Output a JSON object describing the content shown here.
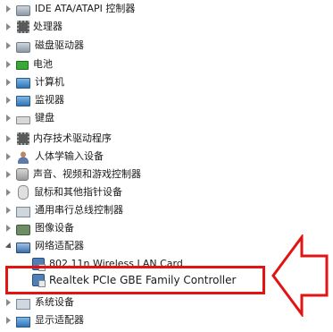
{
  "tree": {
    "items": [
      {
        "label": "IDE ATA/ATAPI 控制器",
        "icon": "disk-controller-icon",
        "expanded": false
      },
      {
        "label": "处理器",
        "icon": "processor-icon",
        "expanded": false
      },
      {
        "label": "磁盘驱动器",
        "icon": "disk-drive-icon",
        "expanded": false
      },
      {
        "label": "电池",
        "icon": "battery-icon",
        "expanded": false
      },
      {
        "label": "计算机",
        "icon": "computer-icon",
        "expanded": false
      },
      {
        "label": "监视器",
        "icon": "monitor-icon",
        "expanded": false
      },
      {
        "label": "键盘",
        "icon": "keyboard-icon",
        "expanded": false
      },
      {
        "label": "内存技术驱动程序",
        "icon": "memory-icon",
        "expanded": false
      },
      {
        "label": "人体学输入设备",
        "icon": "hid-icon",
        "expanded": false
      },
      {
        "label": "声音、视频和游戏控制器",
        "icon": "sound-icon",
        "expanded": false
      },
      {
        "label": "鼠标和其他指针设备",
        "icon": "mouse-icon",
        "expanded": false
      },
      {
        "label": "通用串行总线控制器",
        "icon": "usb-icon",
        "expanded": false
      },
      {
        "label": "图像设备",
        "icon": "camera-icon",
        "expanded": false
      },
      {
        "label": "网络适配器",
        "icon": "network-adapter-icon",
        "expanded": true
      },
      {
        "label": "802.11n Wireless LAN Card",
        "icon": "network-card-icon",
        "child": true
      },
      {
        "label": "Realtek PCIe GBE Family Controller",
        "icon": "network-card-icon",
        "child": true
      },
      {
        "label": "系统设备",
        "icon": "system-device-icon",
        "expanded": false
      },
      {
        "label": "显示适配器",
        "icon": "display-adapter-icon",
        "expanded": false
      }
    ]
  },
  "annotation": {
    "highlight_color": "#e21313",
    "arrow_color": "#e21313"
  }
}
